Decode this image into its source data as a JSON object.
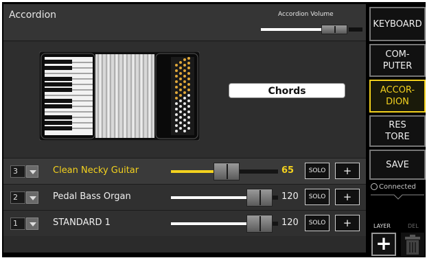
{
  "header": {
    "title": "Accordion",
    "volume_label": "Accordion Volume",
    "volume_level": 0.72
  },
  "chords_button": "Chords",
  "layers": [
    {
      "channel": "3",
      "name": "Clean Necky Guitar",
      "value": "65",
      "level": 0.51,
      "selected": true,
      "solo": "SOLO",
      "plus": "+"
    },
    {
      "channel": "2",
      "name": "Pedal Bass Organ",
      "value": "120",
      "level": 0.9,
      "selected": false,
      "solo": "SOLO",
      "plus": "+"
    },
    {
      "channel": "1",
      "name": "STANDARD 1",
      "value": "120",
      "level": 0.9,
      "selected": false,
      "solo": "SOLO",
      "plus": "+"
    }
  ],
  "sidebar": {
    "keyboard": "KEYBOARD",
    "computer": "COM-\nPUTER",
    "accordion": "ACCOR-\nDION",
    "restore": "RES\nTORE",
    "save": "SAVE",
    "status": "Connected",
    "layer_label": "LAYER",
    "del_label": "DEL",
    "add_icon": "+"
  },
  "colors": {
    "accent": "#f4d21e",
    "background": "#2b2b2b",
    "text": "#f0f0f0"
  }
}
